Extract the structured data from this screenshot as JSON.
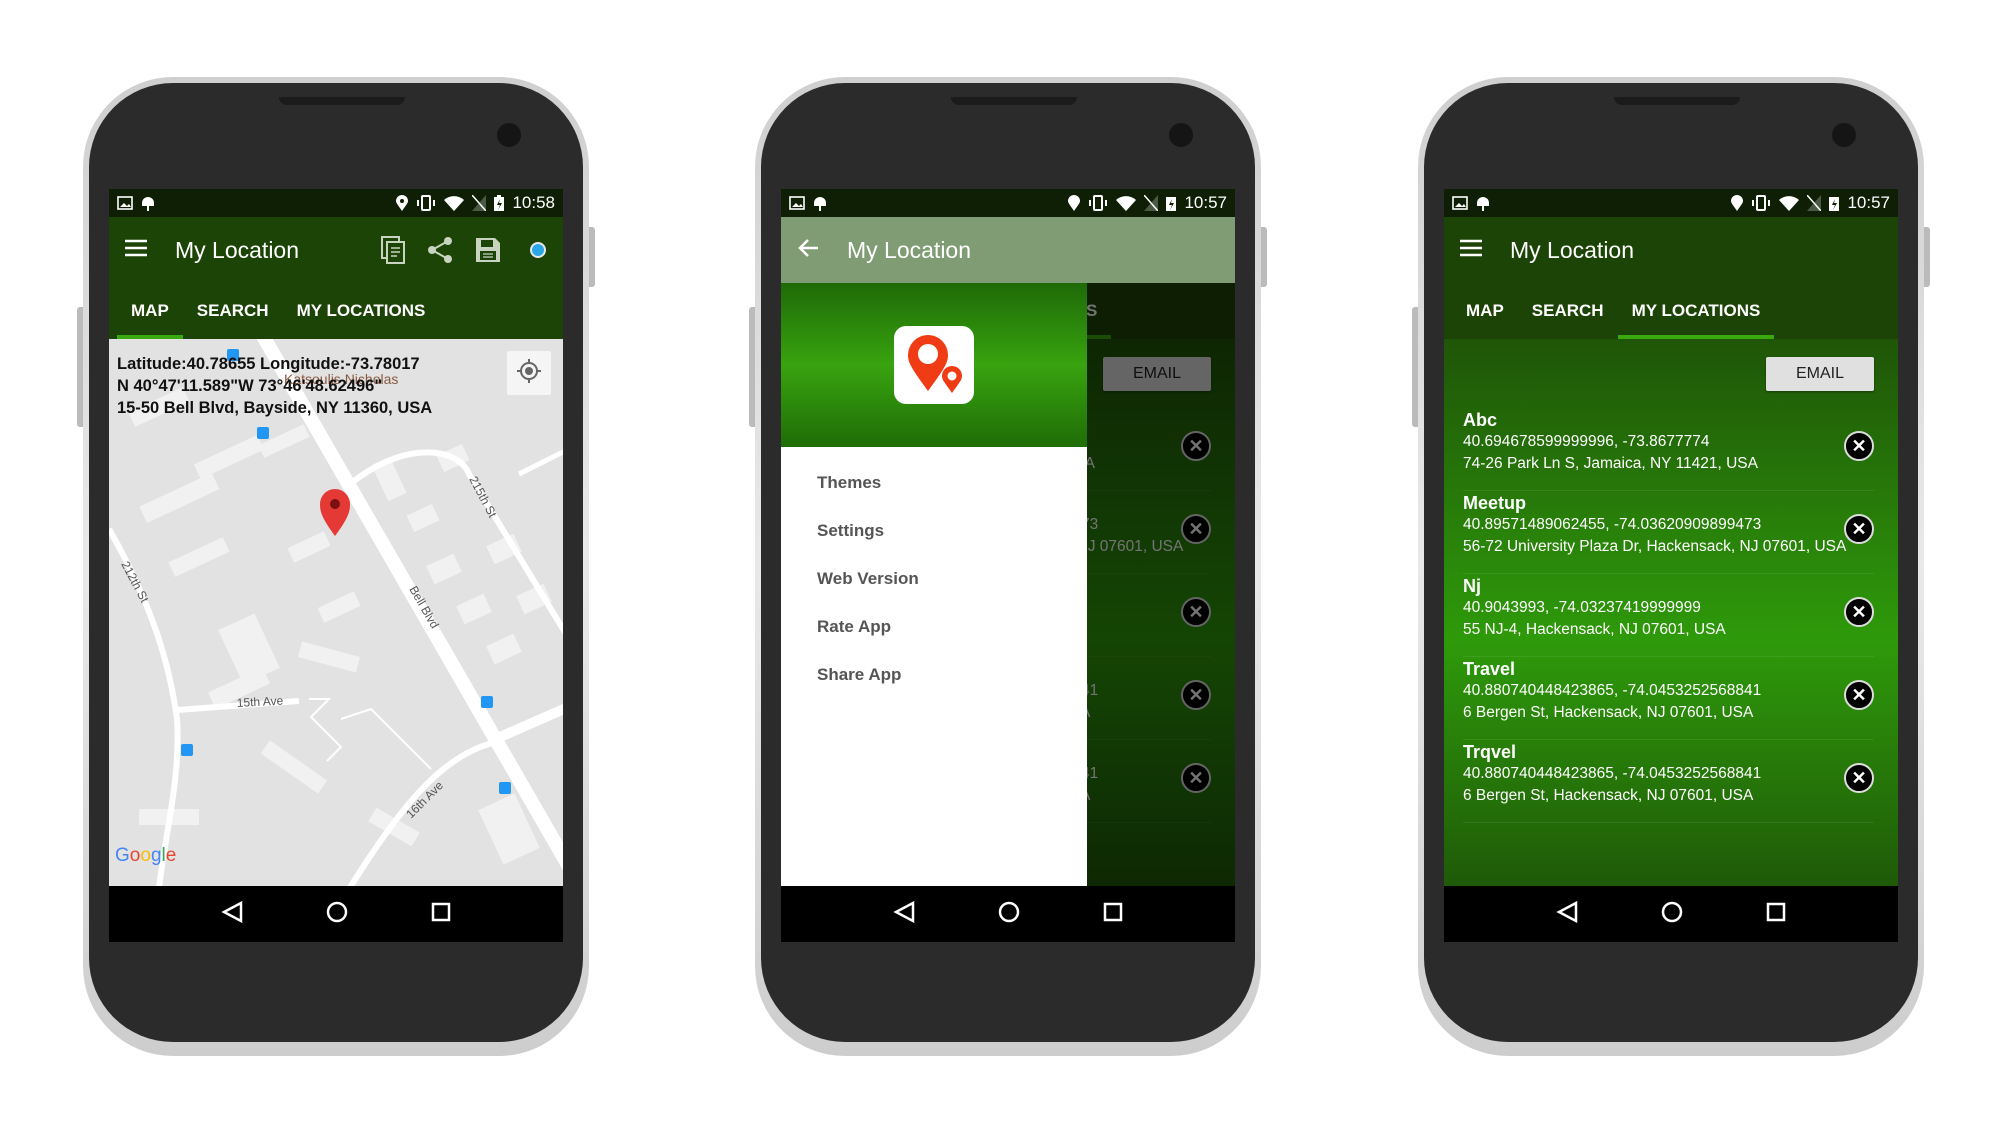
{
  "app": {
    "title": "My Location"
  },
  "colors": {
    "toolbar": "#1d4407",
    "accent": "#3aa80f",
    "drawer_header": "#38a30f",
    "pin": "#e53935"
  },
  "tabs": [
    {
      "label": "MAP"
    },
    {
      "label": "SEARCH"
    },
    {
      "label": "MY LOCATIONS"
    }
  ],
  "phones": [
    {
      "status_time": "10:58",
      "active_tab": "MAP"
    },
    {
      "status_time": "10:57",
      "drawer_open": true
    },
    {
      "status_time": "10:57",
      "active_tab": "MY LOCATIONS"
    }
  ],
  "toolbar_icons": [
    "menu-icon",
    "copy-icon",
    "share-icon",
    "save-icon",
    "location-dot-icon"
  ],
  "map": {
    "latlon": "Latitude:40.78655 Longitude:-73.78017",
    "dms": "N 40°47'11.589\"W 73°46'48.62496\"",
    "address": "15-50 Bell Blvd, Bayside, NY 11360, USA",
    "poi": "Katsoulis Nicholas",
    "streets": {
      "bell": "Bell Blvd",
      "s212": "212th St",
      "s215": "215th St",
      "a15": "15th Ave",
      "a16": "16th Ave"
    },
    "logo": "Google"
  },
  "drawer": {
    "items": [
      "Themes",
      "Settings",
      "Web Version",
      "Rate App",
      "Share App"
    ]
  },
  "list": {
    "email_label": "EMAIL",
    "items": [
      {
        "name": "Abc",
        "coords": "40.694678599999996, -73.8677774",
        "address": "74-26 Park Ln S, Jamaica, NY 11421, USA"
      },
      {
        "name": "Meetup",
        "coords": "40.89571489062455, -74.03620909899473",
        "address": "56-72 University Plaza Dr, Hackensack, NJ 07601, USA"
      },
      {
        "name": "Nj",
        "coords": "40.9043993, -74.03237419999999",
        "address": "55 NJ-4, Hackensack, NJ 07601, USA"
      },
      {
        "name": "Travel",
        "coords": "40.880740448423865, -74.0453252568841",
        "address": "6 Bergen St, Hackensack, NJ 07601, USA"
      },
      {
        "name": "Trqvel",
        "coords": "40.880740448423865, -74.0453252568841",
        "address": "6 Bergen St, Hackensack, NJ 07601, USA"
      }
    ],
    "remove_label": "✕"
  }
}
